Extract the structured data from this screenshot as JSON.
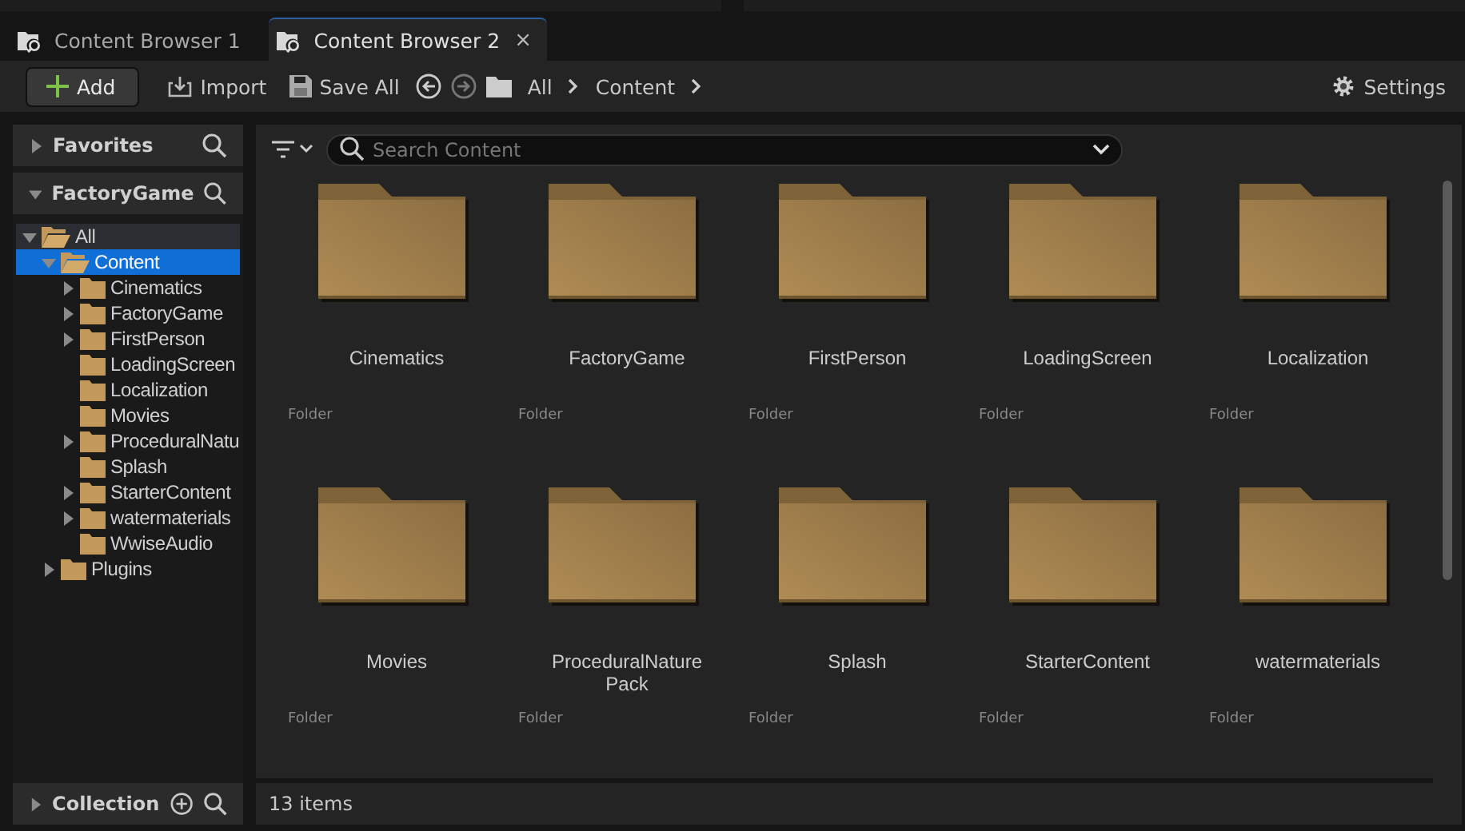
{
  "tabs": [
    {
      "label": "Content Browser 1",
      "selected": false
    },
    {
      "label": "Content Browser 2",
      "selected": true,
      "close": "×"
    }
  ],
  "toolbar": {
    "add": "Add",
    "import": "Import",
    "save_all": "Save All",
    "breadcrumbs": [
      "All",
      "Content"
    ],
    "settings": "Settings"
  },
  "sidebar": {
    "sections": [
      {
        "title": "Favorites",
        "expanded": false
      },
      {
        "title": "FactoryGame",
        "expanded": true
      }
    ],
    "tree": [
      {
        "label": "All",
        "expanded": true,
        "expandable": true,
        "selected": false,
        "children": [
          {
            "label": "Content",
            "expanded": true,
            "expandable": true,
            "selected": true,
            "children": [
              {
                "label": "Cinematics",
                "expanded": false,
                "expandable": true,
                "selected": false
              },
              {
                "label": "FactoryGame",
                "expanded": false,
                "expandable": true,
                "selected": false
              },
              {
                "label": "FirstPerson",
                "expanded": false,
                "expandable": true,
                "selected": false
              },
              {
                "label": "LoadingScreen",
                "expanded": false,
                "expandable": false,
                "selected": false
              },
              {
                "label": "Localization",
                "expanded": false,
                "expandable": false,
                "selected": false
              },
              {
                "label": "Movies",
                "expanded": false,
                "expandable": false,
                "selected": false
              },
              {
                "label": "ProceduralNatu",
                "expanded": false,
                "expandable": true,
                "selected": false
              },
              {
                "label": "Splash",
                "expanded": false,
                "expandable": false,
                "selected": false
              },
              {
                "label": "StarterContent",
                "expanded": false,
                "expandable": true,
                "selected": false
              },
              {
                "label": "watermaterials",
                "expanded": false,
                "expandable": true,
                "selected": false
              },
              {
                "label": "WwiseAudio",
                "expanded": false,
                "expandable": false,
                "selected": false
              }
            ]
          },
          {
            "label": "Plugins",
            "expanded": false,
            "expandable": true,
            "selected": false
          }
        ]
      }
    ],
    "collection": {
      "title": "Collection",
      "expanded": false
    }
  },
  "search": {
    "placeholder": "Search Content"
  },
  "items": [
    {
      "name": "Cinematics",
      "type": "Folder"
    },
    {
      "name": "FactoryGame",
      "type": "Folder"
    },
    {
      "name": "FirstPerson",
      "type": "Folder"
    },
    {
      "name": "LoadingScreen",
      "type": "Folder"
    },
    {
      "name": "Localization",
      "type": "Folder"
    },
    {
      "name": "Movies",
      "type": "Folder"
    },
    {
      "name": "ProceduralNature Pack",
      "type": "Folder"
    },
    {
      "name": "Splash",
      "type": "Folder"
    },
    {
      "name": "StarterContent",
      "type": "Folder"
    },
    {
      "name": "watermaterials",
      "type": "Folder"
    }
  ],
  "status_bar": "13 items"
}
